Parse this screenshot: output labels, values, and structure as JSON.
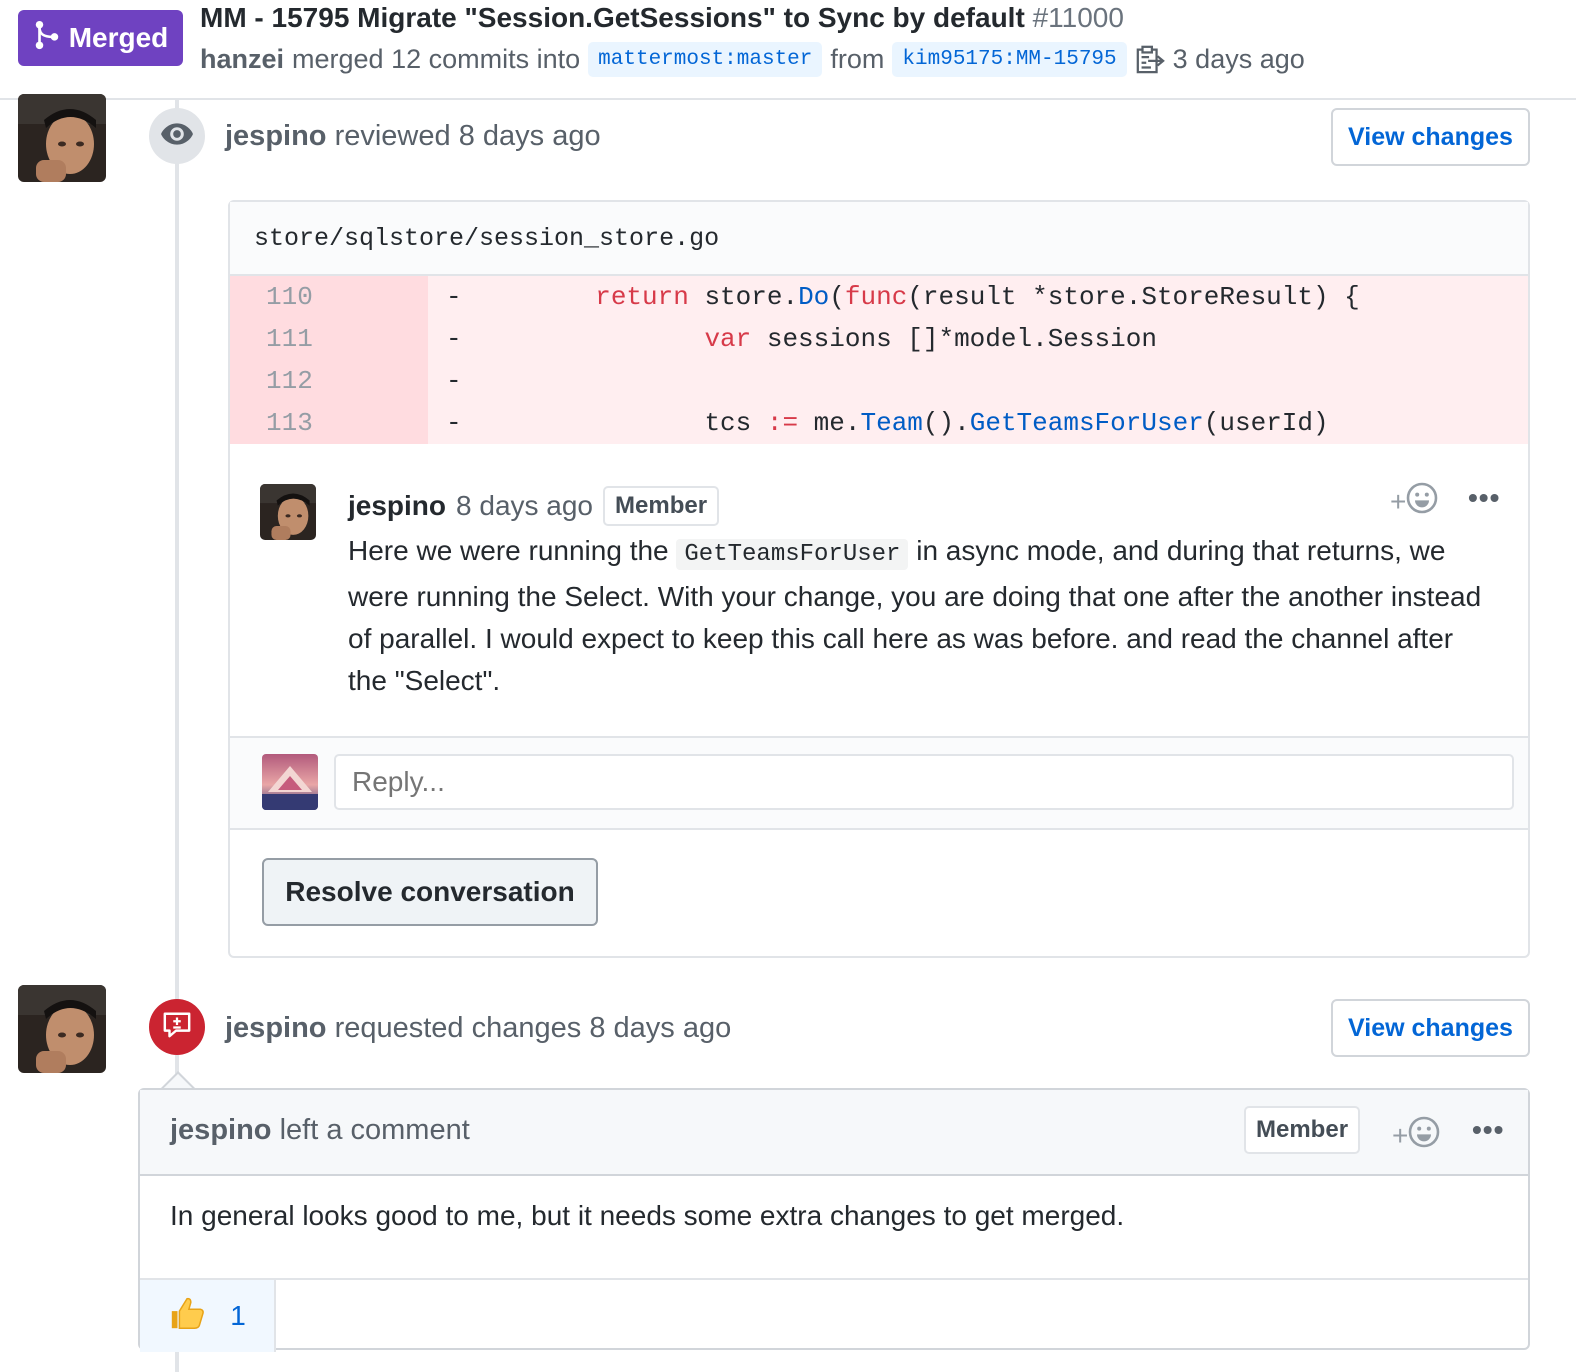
{
  "header": {
    "status": "Merged",
    "title": "MM - 15795 Migrate \"Session.GetSessions\" to Sync by default",
    "number": "#11000",
    "merged_by": "hanzei",
    "merged_text": "merged 12 commits into",
    "base_branch": "mattermost:master",
    "from_text": "from",
    "head_branch": "kim95175:MM-15795",
    "time": "3 days ago",
    "colors": {
      "merged": "#6f42c1",
      "link": "#0366d6"
    }
  },
  "review": {
    "author": "jespino",
    "action": "reviewed 8 days ago",
    "view_changes": "View changes",
    "file": "store/sqlstore/session_store.go",
    "diff": [
      {
        "num": "110",
        "sign": "-"
      },
      {
        "num": "111",
        "sign": "-"
      },
      {
        "num": "112",
        "sign": "-"
      },
      {
        "num": "113",
        "sign": "-"
      }
    ],
    "code": {
      "l110": {
        "indent": "       ",
        "kw1": "return",
        "t1": " store.",
        "fn1": "Do",
        "t2": "(",
        "kw2": "func",
        "t3": "(result *store.StoreResult) {"
      },
      "l111": {
        "indent": "              ",
        "kw": "var",
        "t": " sessions []*model.Session"
      },
      "l113": {
        "indent": "              ",
        "t1": "tcs ",
        "op": ":=",
        "t2": " me.",
        "fn1": "Team",
        "t3": "().",
        "fn2": "GetTeamsForUser",
        "t4": "(userId)"
      }
    },
    "comment": {
      "author": "jespino",
      "time": "8 days ago",
      "role": "Member",
      "body_1": "Here we were running the ",
      "body_code": "GetTeamsForUser",
      "body_2": " in async mode, and during that returns, we were running the Select. With your change, you are doing that one after the another instead of parallel. I would expect to keep this call here as was before. and read the channel after the \"Select\"."
    },
    "reply_placeholder": "Reply...",
    "resolve_label": "Resolve conversation"
  },
  "request": {
    "author": "jespino",
    "action": "requested changes 8 days ago",
    "view_changes": "View changes",
    "card": {
      "author": "jespino",
      "action": "left a comment",
      "role": "Member",
      "body": "In general looks good to me, but it needs some extra changes to get merged.",
      "reaction_count": "1"
    }
  },
  "icons": {
    "merged": "git-merge-icon",
    "copy": "clipboard-copy-icon",
    "eye": "eye-icon",
    "request": "request-changes-icon",
    "emoji": "smiley-icon",
    "more": "kebab-icon",
    "thumb": "thumbs-up-icon"
  }
}
